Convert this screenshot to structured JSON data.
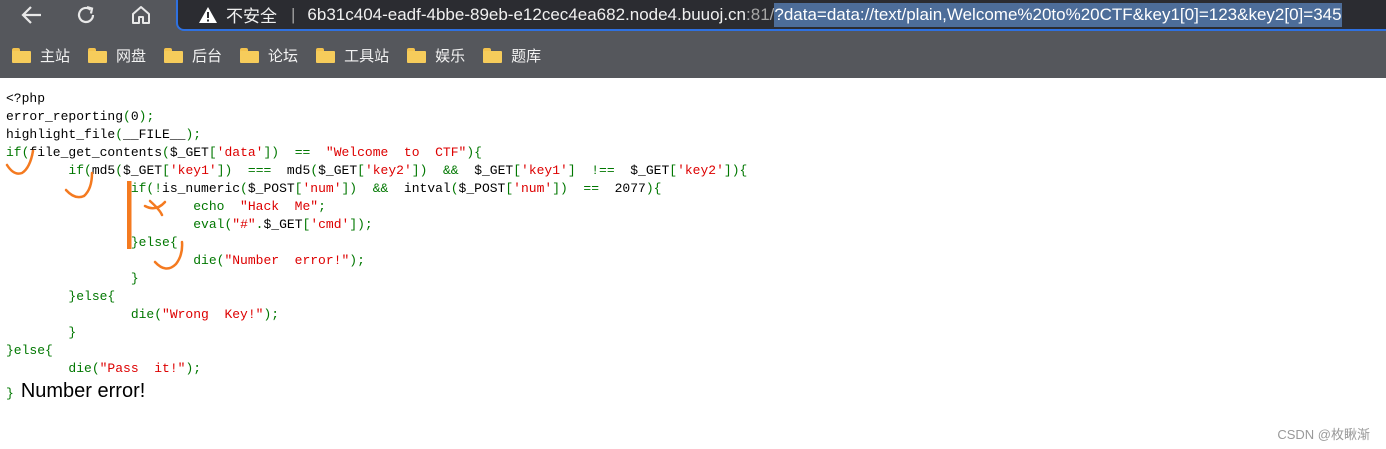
{
  "browser": {
    "security_label": "不安全",
    "url_host": "6b31c404-eadf-4bbe-89eb-e12cec4ea682.node4.buuoj.cn",
    "url_port": ":81/",
    "url_query": "?data=data://text/plain,Welcome%20to%20CTF&key1[0]=123&key2[0]=345"
  },
  "bookmarks": [
    "主站",
    "网盘",
    "后台",
    "论坛",
    "工具站",
    "娱乐",
    "题库"
  ],
  "source_code": [
    [
      {
        "t": "<?php",
        "c": "def"
      }
    ],
    [
      {
        "t": "error_reporting",
        "c": "def"
      },
      {
        "t": "(",
        "c": "key"
      },
      {
        "t": "0",
        "c": "def"
      },
      {
        "t": ");",
        "c": "key"
      }
    ],
    [
      {
        "t": "highlight_file",
        "c": "def"
      },
      {
        "t": "(",
        "c": "key"
      },
      {
        "t": "__FILE__",
        "c": "def"
      },
      {
        "t": ");",
        "c": "key"
      }
    ],
    [
      {
        "t": "if(",
        "c": "key"
      },
      {
        "t": "file_get_contents",
        "c": "def"
      },
      {
        "t": "(",
        "c": "key"
      },
      {
        "t": "$_GET",
        "c": "def"
      },
      {
        "t": "[",
        "c": "key"
      },
      {
        "t": "'data'",
        "c": "str"
      },
      {
        "t": "])  ==  ",
        "c": "key"
      },
      {
        "t": "\"Welcome  to  CTF\"",
        "c": "str"
      },
      {
        "t": "){",
        "c": "key"
      }
    ],
    [
      {
        "t": "        if(",
        "c": "key"
      },
      {
        "t": "md5",
        "c": "def"
      },
      {
        "t": "(",
        "c": "key"
      },
      {
        "t": "$_GET",
        "c": "def"
      },
      {
        "t": "[",
        "c": "key"
      },
      {
        "t": "'key1'",
        "c": "str"
      },
      {
        "t": "])  ===  ",
        "c": "key"
      },
      {
        "t": "md5",
        "c": "def"
      },
      {
        "t": "(",
        "c": "key"
      },
      {
        "t": "$_GET",
        "c": "def"
      },
      {
        "t": "[",
        "c": "key"
      },
      {
        "t": "'key2'",
        "c": "str"
      },
      {
        "t": "])  &&  ",
        "c": "key"
      },
      {
        "t": "$_GET",
        "c": "def"
      },
      {
        "t": "[",
        "c": "key"
      },
      {
        "t": "'key1'",
        "c": "str"
      },
      {
        "t": "]  !==  ",
        "c": "key"
      },
      {
        "t": "$_GET",
        "c": "def"
      },
      {
        "t": "[",
        "c": "key"
      },
      {
        "t": "'key2'",
        "c": "str"
      },
      {
        "t": "]){",
        "c": "key"
      }
    ],
    [
      {
        "t": "                if(!",
        "c": "key"
      },
      {
        "t": "is_numeric",
        "c": "def"
      },
      {
        "t": "(",
        "c": "key"
      },
      {
        "t": "$_POST",
        "c": "def"
      },
      {
        "t": "[",
        "c": "key"
      },
      {
        "t": "'num'",
        "c": "str"
      },
      {
        "t": "])  &&  ",
        "c": "key"
      },
      {
        "t": "intval",
        "c": "def"
      },
      {
        "t": "(",
        "c": "key"
      },
      {
        "t": "$_POST",
        "c": "def"
      },
      {
        "t": "[",
        "c": "key"
      },
      {
        "t": "'num'",
        "c": "str"
      },
      {
        "t": "])  ==  ",
        "c": "key"
      },
      {
        "t": "2077",
        "c": "def"
      },
      {
        "t": "){",
        "c": "key"
      }
    ],
    [
      {
        "t": "                        echo  ",
        "c": "key"
      },
      {
        "t": "\"Hack  Me\"",
        "c": "str"
      },
      {
        "t": ";",
        "c": "key"
      }
    ],
    [
      {
        "t": "                        ",
        "c": "key"
      },
      {
        "t": "eval",
        "c": "key"
      },
      {
        "t": "(",
        "c": "key"
      },
      {
        "t": "\"#\"",
        "c": "str"
      },
      {
        "t": ".",
        "c": "key"
      },
      {
        "t": "$_GET",
        "c": "def"
      },
      {
        "t": "[",
        "c": "key"
      },
      {
        "t": "'cmd'",
        "c": "str"
      },
      {
        "t": "]);",
        "c": "key"
      }
    ],
    [
      {
        "t": "                }else{",
        "c": "key"
      }
    ],
    [
      {
        "t": "                        die(",
        "c": "key"
      },
      {
        "t": "\"Number  error!\"",
        "c": "str"
      },
      {
        "t": ");",
        "c": "key"
      }
    ],
    [
      {
        "t": "                }",
        "c": "key"
      }
    ],
    [
      {
        "t": "        }else{",
        "c": "key"
      }
    ],
    [
      {
        "t": "                die(",
        "c": "key"
      },
      {
        "t": "\"Wrong  Key!\"",
        "c": "str"
      },
      {
        "t": ");",
        "c": "key"
      }
    ],
    [
      {
        "t": "        }",
        "c": "key"
      }
    ],
    [
      {
        "t": "}else{",
        "c": "key"
      }
    ],
    [
      {
        "t": "        die(",
        "c": "key"
      },
      {
        "t": "\"Pass  it!\"",
        "c": "str"
      },
      {
        "t": ");",
        "c": "key"
      }
    ]
  ],
  "closing_brace": "}",
  "page_output": "Number error!",
  "watermark": "CSDN @枚瞅渐",
  "colors": {
    "php_default": "#000000",
    "php_keyword": "#007700",
    "php_string": "#dd0000",
    "annotation": "#f47a20",
    "url_selection": "#4d6d99"
  }
}
